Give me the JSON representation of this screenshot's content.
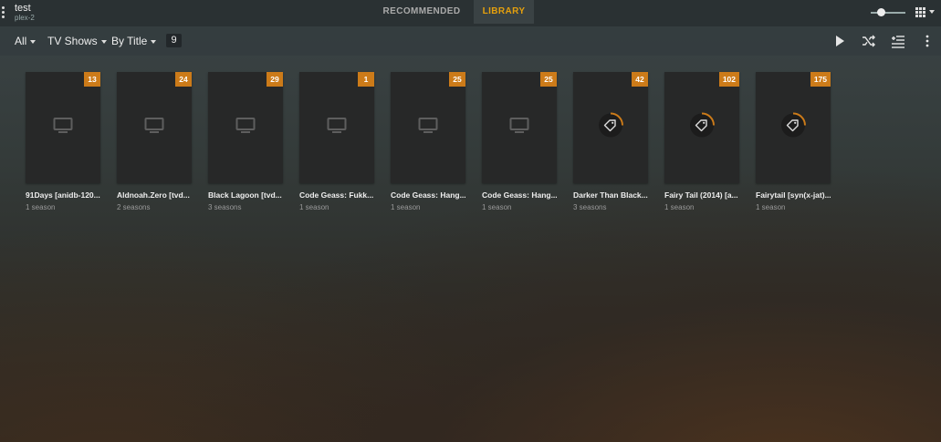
{
  "server": {
    "title": "test",
    "subtitle": "plex-2"
  },
  "tabs": [
    {
      "label": "RECOMMENDED"
    },
    {
      "label": "LIBRARY"
    }
  ],
  "filters": {
    "all_label": "All",
    "type_label": "TV Shows",
    "sort_label": "By Title",
    "count": "9"
  },
  "icons": {
    "play": "play-icon",
    "shuffle": "shuffle-icon",
    "queue": "add-to-queue-icon",
    "more": "more-vertical-icon",
    "grid": "grid-view-icon"
  },
  "colors": {
    "accent": "#e5a00d",
    "badge": "#cc7b19"
  },
  "shows": [
    {
      "title": "91Days [anidb-120...",
      "subtitle": "1 season",
      "count": "13",
      "icon": "tv-icon"
    },
    {
      "title": "Aldnoah.Zero [tvd...",
      "subtitle": "2 seasons",
      "count": "24",
      "icon": "tv-icon"
    },
    {
      "title": "Black Lagoon [tvd...",
      "subtitle": "3 seasons",
      "count": "29",
      "icon": "tv-icon"
    },
    {
      "title": "Code Geass: Fukk...",
      "subtitle": "1 season",
      "count": "1",
      "icon": "tv-icon"
    },
    {
      "title": "Code Geass: Hang...",
      "subtitle": "1 season",
      "count": "25",
      "icon": "tv-icon"
    },
    {
      "title": "Code Geass: Hang...",
      "subtitle": "1 season",
      "count": "25",
      "icon": "tv-icon"
    },
    {
      "title": "Darker Than Black...",
      "subtitle": "3 seasons",
      "count": "42",
      "icon": "tag-loading-icon"
    },
    {
      "title": "Fairy Tail (2014) [a...",
      "subtitle": "1 season",
      "count": "102",
      "icon": "tag-loading-icon"
    },
    {
      "title": "Fairytail [syn(x-jat)...",
      "subtitle": "1 season",
      "count": "175",
      "icon": "tag-loading-icon"
    }
  ]
}
